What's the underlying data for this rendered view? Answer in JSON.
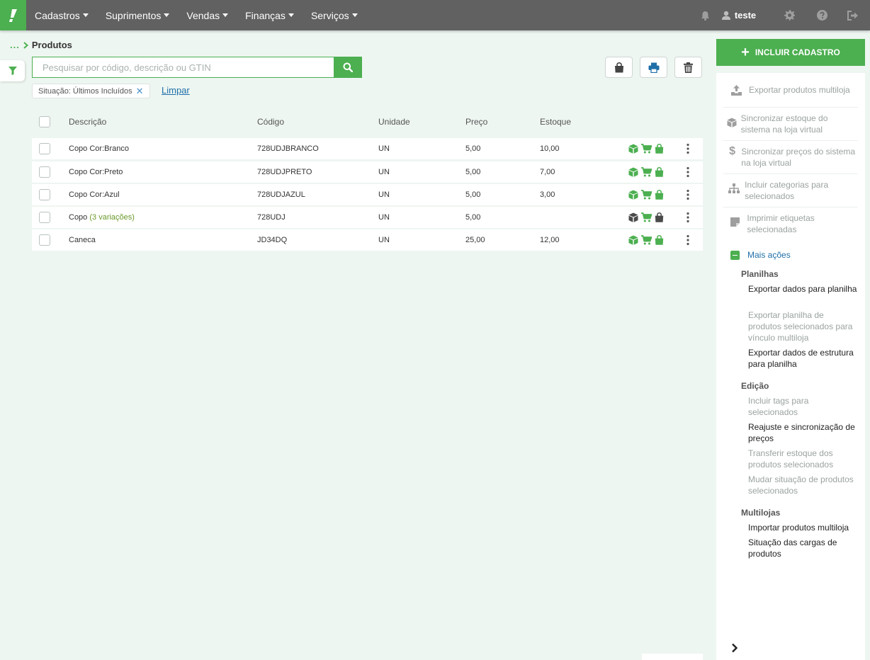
{
  "nav": {
    "items": [
      {
        "label": "Cadastros"
      },
      {
        "label": "Suprimentos"
      },
      {
        "label": "Vendas"
      },
      {
        "label": "Finanças"
      },
      {
        "label": "Serviços"
      }
    ],
    "username": "teste",
    "icons": [
      "bell-icon",
      "user-icon",
      "gear-icon",
      "help-icon",
      "logout-icon"
    ]
  },
  "breadcrumb": {
    "dots": "...",
    "title": "Produtos"
  },
  "search": {
    "placeholder": "Pesquisar por código, descrição ou GTIN"
  },
  "filters": {
    "chip": "Situação: Últimos Incluídos",
    "clear": "Limpar"
  },
  "table": {
    "headers": {
      "description": "Descrição",
      "code": "Código",
      "unit": "Unidade",
      "price": "Preço",
      "stock": "Estoque"
    },
    "rows": [
      {
        "description": "Copo Cor:Branco",
        "variations": "",
        "code": "728UDJBRANCO",
        "unit": "UN",
        "price": "5,00",
        "stock": "10,00",
        "dark": false
      },
      {
        "description": "Copo Cor:Preto",
        "variations": "",
        "code": "728UDJPRETO",
        "unit": "UN",
        "price": "5,00",
        "stock": "7,00",
        "dark": false
      },
      {
        "description": "Copo Cor:Azul",
        "variations": "",
        "code": "728UDJAZUL",
        "unit": "UN",
        "price": "5,00",
        "stock": "3,00",
        "dark": false
      },
      {
        "description": "Copo",
        "variations": "(3 variações)",
        "code": "728UDJ",
        "unit": "UN",
        "price": "5,00",
        "stock": "",
        "dark": true
      },
      {
        "description": "Caneca",
        "variations": "",
        "code": "JD34DQ",
        "unit": "UN",
        "price": "25,00",
        "stock": "12,00",
        "dark": false
      }
    ]
  },
  "sidebar": {
    "include_button": "INCLUIR CADASTRO",
    "actions": [
      "Exportar produtos multiloja",
      "Sincronizar estoque do sistema na loja virtual",
      "Sincronizar preços do sistema na loja virtual",
      "Incluir categorias para selecionados",
      "Imprimir etiquetas selecionadas"
    ],
    "more_actions": "Mais ações",
    "sections": [
      {
        "title": "Planilhas",
        "items": [
          "Exportar dados para planilha",
          "Exportar planilha de produtos selecionados para vínculo multiloja",
          "Exportar dados de estrutura para planilha"
        ]
      },
      {
        "title": "Edição",
        "items": [
          "Incluir tags para selecionados",
          "Reajuste e sincronização de preços",
          "Transferir estoque dos produtos selecionados",
          "Mudar situação de produtos selecionados"
        ]
      },
      {
        "title": "Multilojas",
        "items": [
          "Importar produtos multiloja",
          "Situação das cargas de produtos"
        ]
      }
    ]
  },
  "colors": {
    "accent": "#4caf50",
    "topbar": "#616161",
    "link": "#1f6fa8",
    "background": "#eef6f1"
  }
}
